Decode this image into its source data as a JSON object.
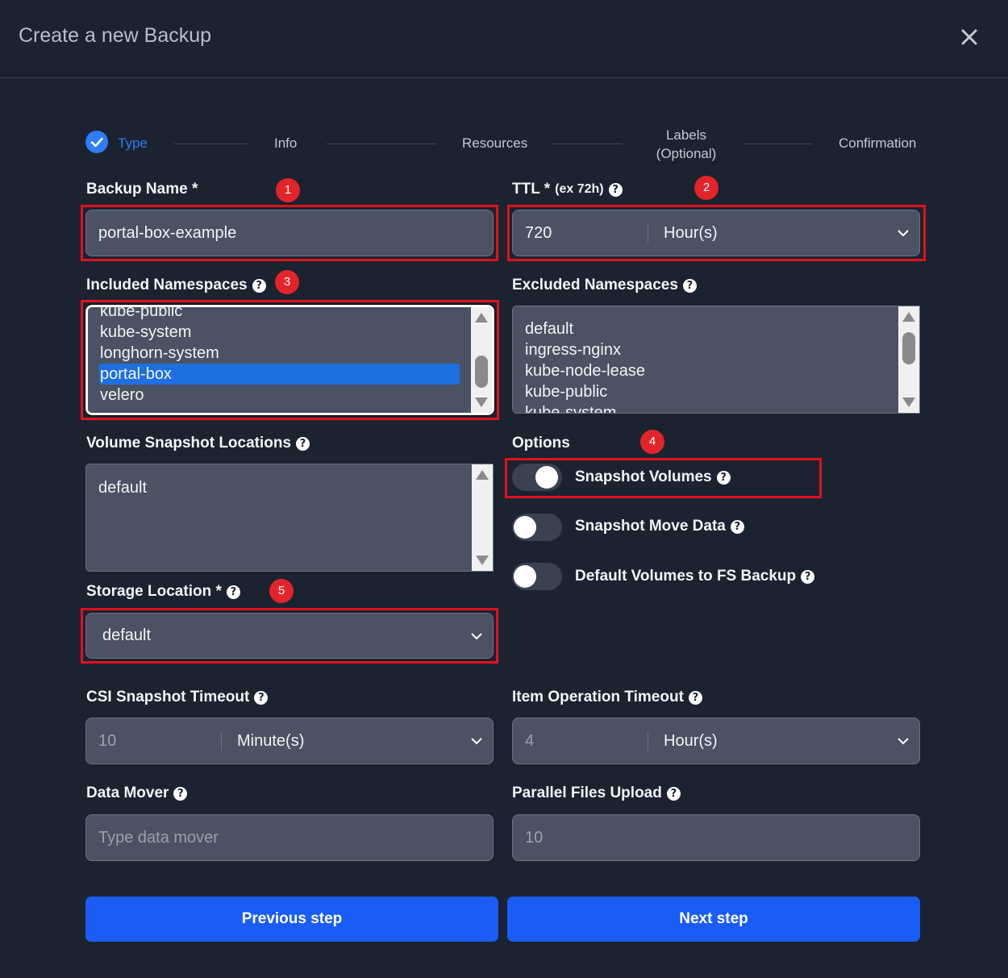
{
  "dialog": {
    "title": "Create a new Backup"
  },
  "steps": [
    {
      "label": "Type",
      "active": true
    },
    {
      "label": "Info"
    },
    {
      "label": "Resources"
    },
    {
      "label": "Labels",
      "label2": "(Optional)"
    },
    {
      "label": "Confirmation"
    }
  ],
  "badges": [
    "1",
    "2",
    "3",
    "4",
    "5"
  ],
  "fields": {
    "backup_name": {
      "label": "Backup Name *",
      "value": "portal-box-example"
    },
    "ttl": {
      "label": "TTL *",
      "hint": "(ex 72h)",
      "value": "720",
      "unit": "Hour(s)"
    },
    "included_namespaces": {
      "label": "Included Namespaces",
      "items": [
        "kube-public",
        "kube-system",
        "longhorn-system",
        "portal-box",
        "velero"
      ],
      "selected": "portal-box"
    },
    "excluded_namespaces": {
      "label": "Excluded Namespaces",
      "items": [
        "default",
        "ingress-nginx",
        "kube-node-lease",
        "kube-public",
        "kube-system"
      ]
    },
    "volume_snapshot_locations": {
      "label": "Volume Snapshot Locations",
      "items": [
        "default"
      ]
    },
    "storage_location": {
      "label": "Storage Location *",
      "value": "default"
    },
    "csi_snapshot_timeout": {
      "label": "CSI Snapshot Timeout",
      "value": "10",
      "unit": "Minute(s)"
    },
    "item_operation_timeout": {
      "label": "Item Operation Timeout",
      "value": "4",
      "unit": "Hour(s)"
    },
    "data_mover": {
      "label": "Data Mover",
      "placeholder": "Type data mover"
    },
    "parallel_files_upload": {
      "label": "Parallel Files Upload",
      "placeholder": "10"
    }
  },
  "options": {
    "label": "Options",
    "toggles": [
      {
        "label": "Snapshot Volumes",
        "on": true
      },
      {
        "label": "Snapshot Move Data",
        "on": false
      },
      {
        "label": "Default Volumes to FS Backup",
        "on": false
      }
    ]
  },
  "buttons": {
    "previous": "Previous step",
    "next": "Next step"
  },
  "colors": {
    "accent": "#1a5cf5",
    "highlight": "#e1121a",
    "background": "#1b2230"
  }
}
